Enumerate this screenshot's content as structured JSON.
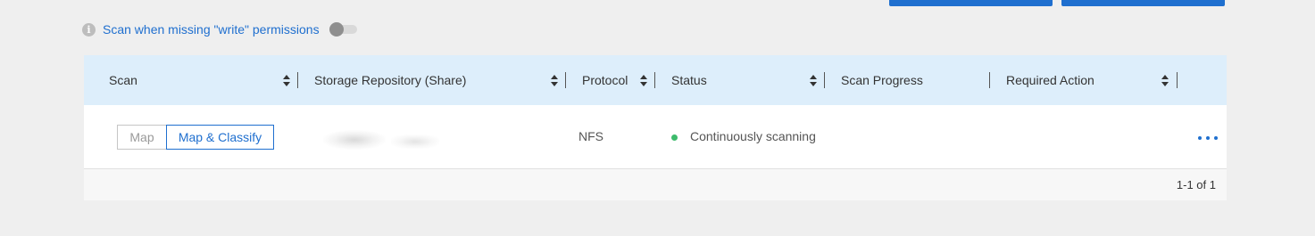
{
  "scan_option": {
    "info_icon_glyph": "i",
    "label": "Scan when missing \"write\" permissions",
    "toggle_state": "off"
  },
  "table": {
    "columns": [
      {
        "label": "Scan",
        "sortable": true
      },
      {
        "label": "Storage Repository (Share)",
        "sortable": true
      },
      {
        "label": "Protocol",
        "sortable": true
      },
      {
        "label": "Status",
        "sortable": true
      },
      {
        "label": "Scan Progress",
        "sortable": false
      },
      {
        "label": "Required Action",
        "sortable": true
      }
    ],
    "rows": [
      {
        "scan_options": [
          "Map",
          "Map & Classify"
        ],
        "scan_selected": "Map & Classify",
        "protocol": "NFS",
        "status": "Continuously scanning",
        "status_color": "#3dbb6c"
      }
    ],
    "pagination": "1-1 of 1"
  },
  "colors": {
    "accent": "#1f6fcf",
    "header_bg": "#ddeefb",
    "page_bg": "#efefef"
  }
}
